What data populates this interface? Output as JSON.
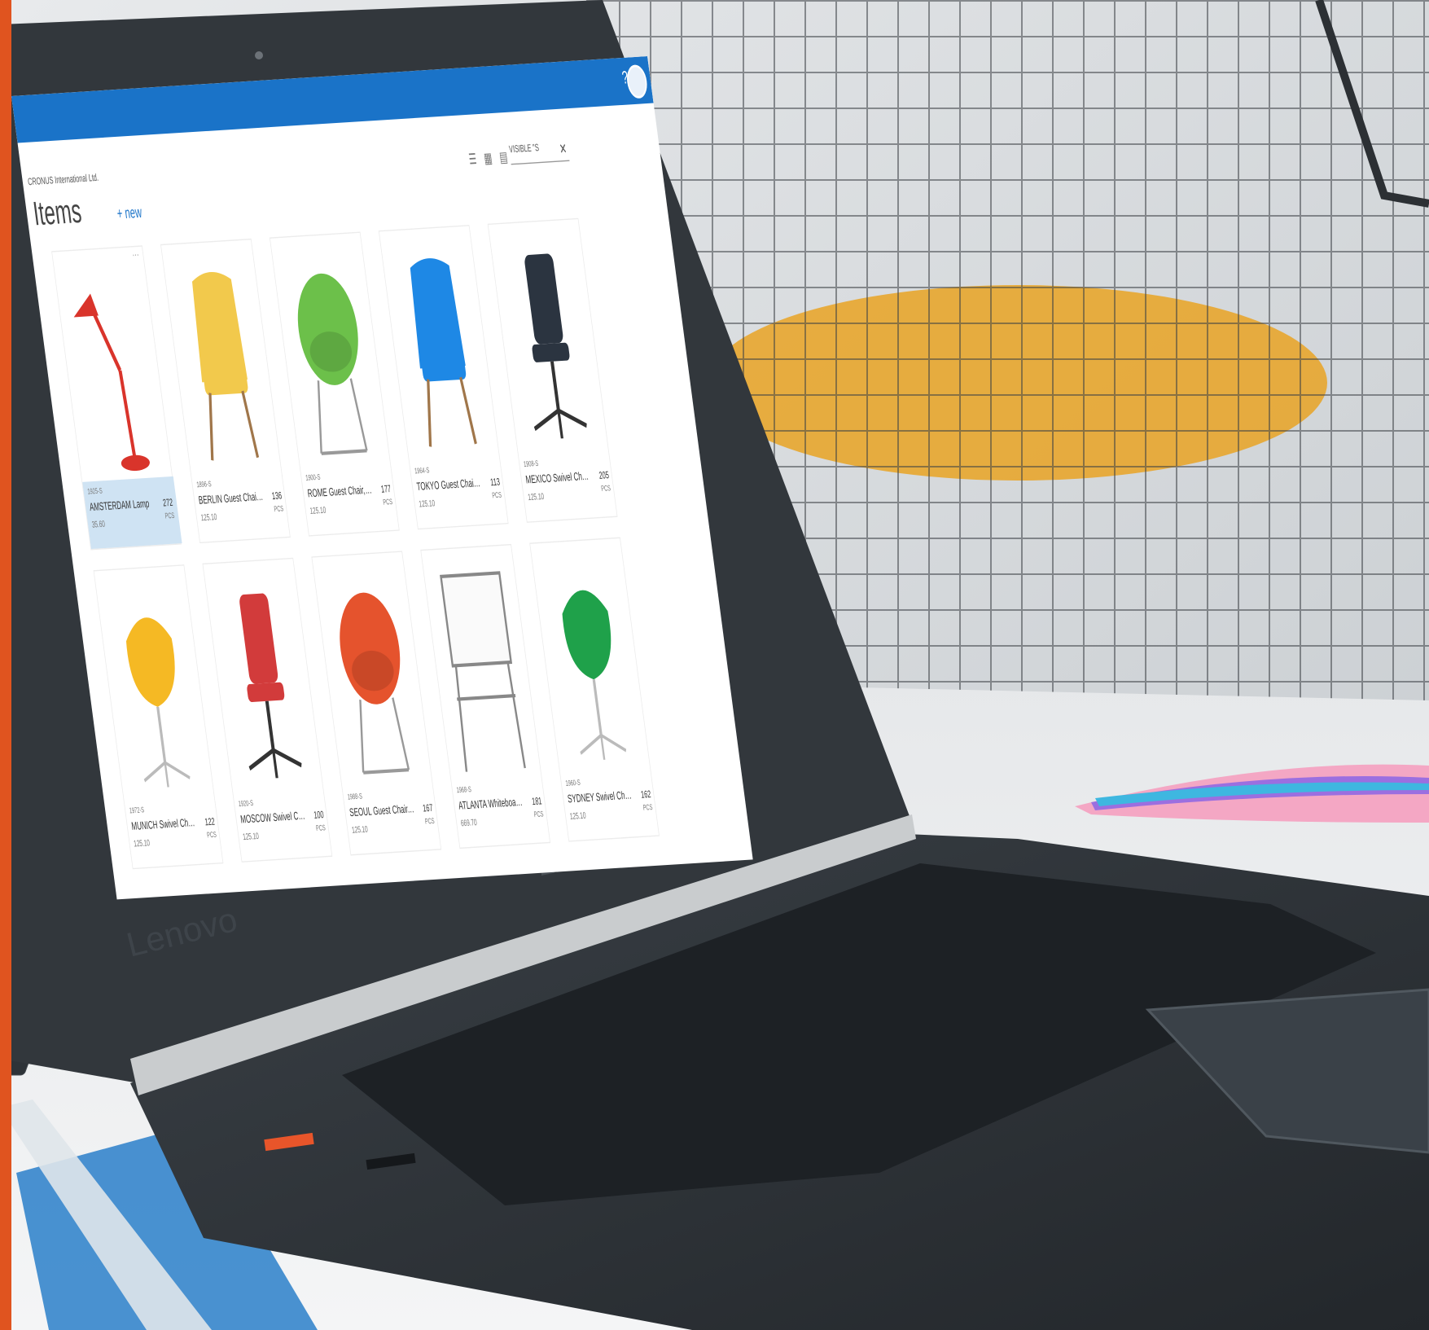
{
  "app": {
    "company": "CRONUS International Ltd.",
    "page_title": "Items",
    "new_label": "+ new",
    "help_label": "?",
    "search_value": "VISIBLE \"S",
    "view_icons": "☰ ▦ ▤"
  },
  "hardware": {
    "brand_text": "Lenovo"
  },
  "items": [
    {
      "no": "1925-S",
      "desc": "AMSTERDAM Lamp",
      "qty": "272",
      "unit": "PCS",
      "price": "35.60",
      "color": "#d9342b",
      "kind": "lamp",
      "selected": true
    },
    {
      "no": "1896-S",
      "desc": "BERLIN Guest Chair, yellow",
      "qty": "136",
      "unit": "PCS",
      "price": "125.10",
      "color": "#f2c94c",
      "kind": "wing"
    },
    {
      "no": "1900-S",
      "desc": "ROME Guest Chair, green",
      "qty": "177",
      "unit": "PCS",
      "price": "125.10",
      "color": "#6cc04a",
      "kind": "egg"
    },
    {
      "no": "1964-S",
      "desc": "TOKYO Guest Chair, blue",
      "qty": "113",
      "unit": "PCS",
      "price": "125.10",
      "color": "#1e88e5",
      "kind": "wing"
    },
    {
      "no": "1908-S",
      "desc": "MEXICO Swivel Chair, black",
      "qty": "205",
      "unit": "PCS",
      "price": "125.10",
      "color": "#2b3440",
      "kind": "office"
    },
    {
      "no": "1972-S",
      "desc": "MUNICH Swivel Chair, yellow",
      "qty": "122",
      "unit": "PCS",
      "price": "125.10",
      "color": "#f5b924",
      "kind": "swan"
    },
    {
      "no": "1920-S",
      "desc": "MOSCOW Swivel Chair, red",
      "qty": "100",
      "unit": "PCS",
      "price": "125.10",
      "color": "#d23b3b",
      "kind": "office"
    },
    {
      "no": "1988-S",
      "desc": "SEOUL Guest Chair, red",
      "qty": "167",
      "unit": "PCS",
      "price": "125.10",
      "color": "#e5532d",
      "kind": "egg"
    },
    {
      "no": "1968-S",
      "desc": "ATLANTA Whiteboard, base",
      "qty": "181",
      "unit": "PCS",
      "price": "669.70",
      "color": "#eeeeee",
      "kind": "board"
    },
    {
      "no": "1960-S",
      "desc": "SYDNEY Swivel Chair, green",
      "qty": "162",
      "unit": "PCS",
      "price": "125.10",
      "color": "#1fa14a",
      "kind": "swan"
    }
  ],
  "colors": {
    "accent": "#1a73c8",
    "left_bar": "#e0541f",
    "bezel": "#33383d",
    "body": "#2b3035"
  }
}
